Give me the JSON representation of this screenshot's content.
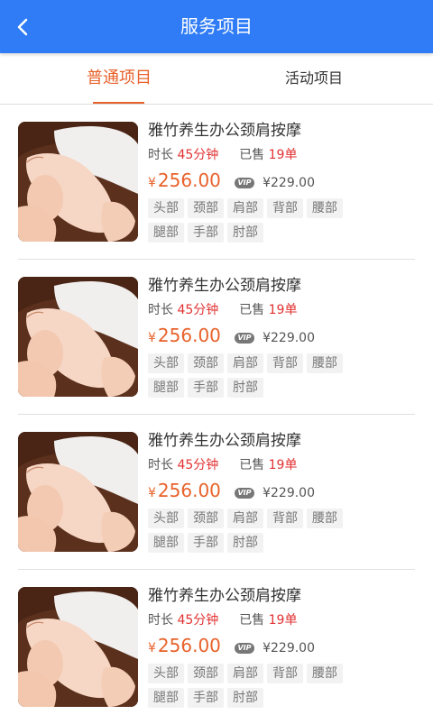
{
  "header": {
    "title": "服务项目",
    "back_icon": "chevron-left-icon",
    "color": "#2f7cf6"
  },
  "tabs": [
    {
      "label": "普通项目",
      "active": true
    },
    {
      "label": "活动项目",
      "active": false
    }
  ],
  "accent_color": "#e8622b",
  "items": [
    {
      "name": "雅竹养生办公颈肩按摩",
      "duration_label": "时长",
      "duration": "45分钟",
      "sold_label": "已售",
      "sold": "19单",
      "currency": "¥",
      "price": "256.00",
      "vip_badge": "VIP",
      "vip_price": "¥229.00",
      "tags": [
        "头部",
        "颈部",
        "肩部",
        "背部",
        "腰部",
        "腿部",
        "手部",
        "肘部"
      ]
    },
    {
      "name": "雅竹养生办公颈肩按摩",
      "duration_label": "时长",
      "duration": "45分钟",
      "sold_label": "已售",
      "sold": "19单",
      "currency": "¥",
      "price": "256.00",
      "vip_badge": "VIP",
      "vip_price": "¥229.00",
      "tags": [
        "头部",
        "颈部",
        "肩部",
        "背部",
        "腰部",
        "腿部",
        "手部",
        "肘部"
      ]
    },
    {
      "name": "雅竹养生办公颈肩按摩",
      "duration_label": "时长",
      "duration": "45分钟",
      "sold_label": "已售",
      "sold": "19单",
      "currency": "¥",
      "price": "256.00",
      "vip_badge": "VIP",
      "vip_price": "¥229.00",
      "tags": [
        "头部",
        "颈部",
        "肩部",
        "背部",
        "腰部",
        "腿部",
        "手部",
        "肘部"
      ]
    },
    {
      "name": "雅竹养生办公颈肩按摩",
      "duration_label": "时长",
      "duration": "45分钟",
      "sold_label": "已售",
      "sold": "19单",
      "currency": "¥",
      "price": "256.00",
      "vip_badge": "VIP",
      "vip_price": "¥229.00",
      "tags": [
        "头部",
        "颈部",
        "肩部",
        "背部",
        "腰部",
        "腿部",
        "手部",
        "肘部"
      ]
    }
  ]
}
